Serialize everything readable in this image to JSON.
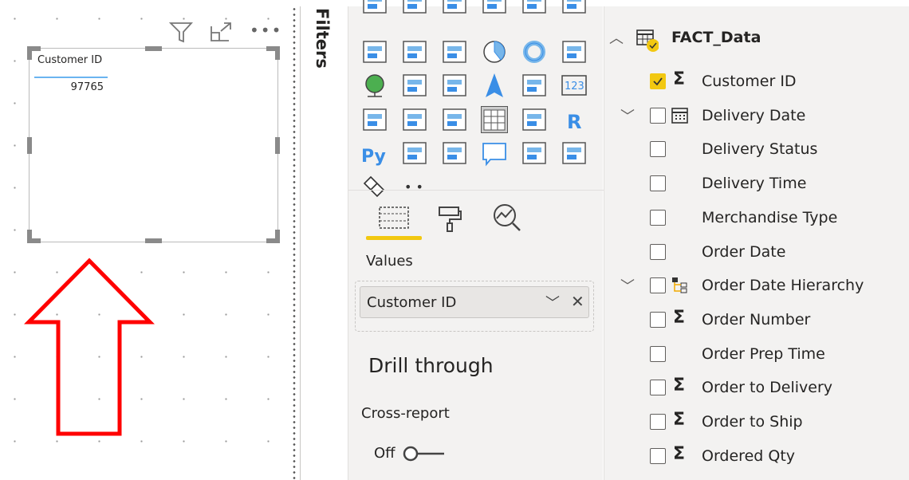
{
  "visual": {
    "column_header": "Customer ID",
    "value": "97765",
    "icons": [
      "filter-icon",
      "focus-mode-icon",
      "more-options-icon"
    ]
  },
  "filters_pane": {
    "title": "Filters"
  },
  "visualizations": {
    "icons": [
      "stacked-bar",
      "stacked-column",
      "clustered-bar",
      "clustered-column",
      "100-stacked-bar",
      "100-stacked-column",
      "ribbon-chart",
      "funnel",
      "scatter",
      "pie",
      "donut",
      "treemap",
      "map",
      "filled-map",
      "shape-map",
      "azure-map",
      "gauge",
      "card",
      "multi-row-card",
      "kpi",
      "slicer",
      "table",
      "matrix",
      "r-visual",
      "python-visual",
      "key-influencers",
      "decomposition-tree",
      "qa",
      "smart-narrative",
      "arcgis-map",
      "power-apps",
      "more"
    ],
    "tabs": [
      "fields-tab",
      "format-tab",
      "analytics-tab"
    ],
    "values_label": "Values",
    "values_field": "Customer ID",
    "drill_through": "Drill through",
    "cross_report": "Cross-report",
    "toggle_state": "Off",
    "toggle_on": false,
    "accent": "#f2c811"
  },
  "fields": {
    "table": "FACT_Data",
    "items": [
      {
        "name": "Customer ID",
        "checked": true,
        "icon": "sigma",
        "expand": false
      },
      {
        "name": "Delivery Date",
        "checked": false,
        "icon": "calendar",
        "expand": true
      },
      {
        "name": "Delivery Status",
        "checked": false,
        "icon": "",
        "expand": false
      },
      {
        "name": "Delivery Time",
        "checked": false,
        "icon": "",
        "expand": false
      },
      {
        "name": "Merchandise Type",
        "checked": false,
        "icon": "",
        "expand": false
      },
      {
        "name": "Order Date",
        "checked": false,
        "icon": "",
        "expand": false
      },
      {
        "name": "Order Date Hierarchy",
        "checked": false,
        "icon": "hierarchy",
        "expand": true
      },
      {
        "name": "Order Number",
        "checked": false,
        "icon": "sigma",
        "expand": false
      },
      {
        "name": "Order Prep Time",
        "checked": false,
        "icon": "",
        "expand": false
      },
      {
        "name": "Order to Delivery",
        "checked": false,
        "icon": "sigma",
        "expand": false
      },
      {
        "name": "Order to Ship",
        "checked": false,
        "icon": "sigma",
        "expand": false
      },
      {
        "name": "Ordered Qty",
        "checked": false,
        "icon": "sigma",
        "expand": false
      }
    ]
  },
  "annotation": {
    "arrow_color": "#ff0000"
  }
}
